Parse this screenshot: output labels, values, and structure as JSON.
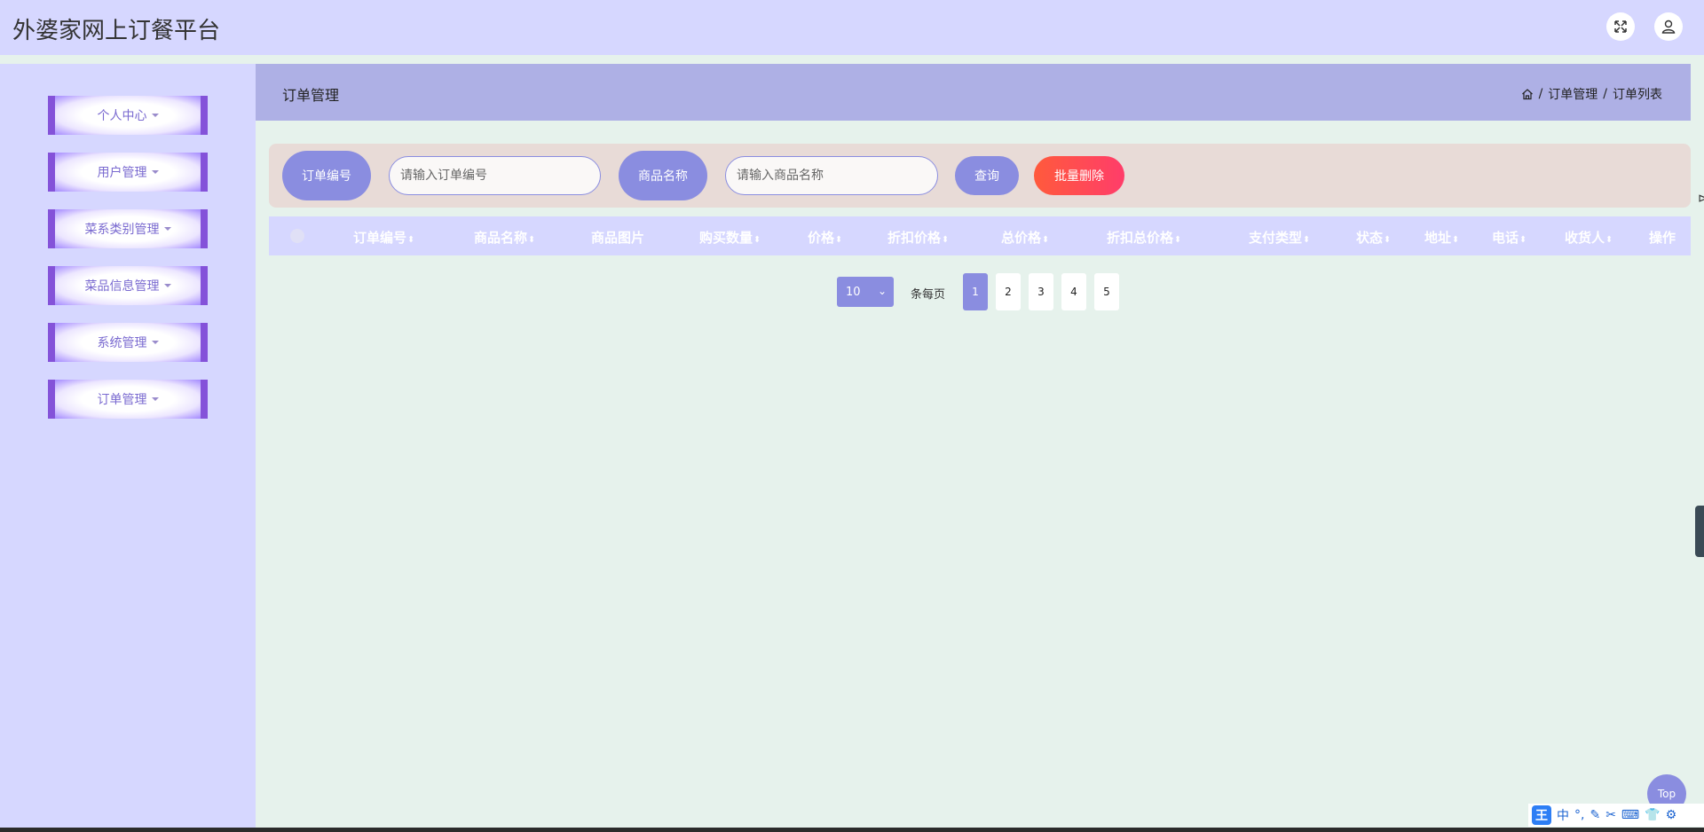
{
  "header": {
    "title": "外婆家网上订餐平台",
    "fullscreen_icon": "expand-icon",
    "user_icon": "user-icon"
  },
  "sidebar": {
    "items": [
      {
        "label": "个人中心"
      },
      {
        "label": "用户管理"
      },
      {
        "label": "菜系类别管理"
      },
      {
        "label": "菜品信息管理"
      },
      {
        "label": "系统管理"
      },
      {
        "label": "订单管理"
      }
    ]
  },
  "page": {
    "title": "订单管理",
    "breadcrumb": {
      "home_icon": "home-icon",
      "sep": "/",
      "level1": "订单管理",
      "level2": "订单列表"
    }
  },
  "search": {
    "order_no_label": "订单编号",
    "order_no_placeholder": "请输入订单编号",
    "product_name_label": "商品名称",
    "product_name_placeholder": "请输入商品名称",
    "query_label": "查询",
    "batch_delete_label": "批量删除"
  },
  "table": {
    "columns": [
      {
        "label": "订单编号",
        "sortable": true
      },
      {
        "label": "商品名称",
        "sortable": true
      },
      {
        "label": "商品图片",
        "sortable": false
      },
      {
        "label": "购买数量",
        "sortable": true
      },
      {
        "label": "价格",
        "sortable": true
      },
      {
        "label": "折扣价格",
        "sortable": true
      },
      {
        "label": "总价格",
        "sortable": true
      },
      {
        "label": "折扣总价格",
        "sortable": true
      },
      {
        "label": "支付类型",
        "sortable": true
      },
      {
        "label": "状态",
        "sortable": true
      },
      {
        "label": "地址",
        "sortable": true
      },
      {
        "label": "电话",
        "sortable": true
      },
      {
        "label": "收货人",
        "sortable": true
      },
      {
        "label": "操作",
        "sortable": false
      }
    ],
    "sort_glyph": "⬍"
  },
  "pagination": {
    "page_size": "10",
    "per_page_label": "条每页",
    "pages": [
      "1",
      "2",
      "3",
      "4",
      "5"
    ],
    "current_page": "1"
  },
  "floating": {
    "top_label": "Top"
  },
  "ime": {
    "logo": "王",
    "mode": "中",
    "icons": [
      "punctuation-icon",
      "pen-icon",
      "scissors-icon",
      "keyboard-icon",
      "skin-icon",
      "settings-icon"
    ]
  },
  "colors": {
    "header_bg": "#d6d7ff",
    "accent": "#8a8de0",
    "menu_border": "#8452d9",
    "title_bar_bg": "#aeb0e5",
    "search_panel_bg": "#e8dbd7",
    "danger_gradient_start": "#ff5a3c",
    "danger_gradient_end": "#ff3d6a",
    "content_bg": "#e6f2ec"
  }
}
